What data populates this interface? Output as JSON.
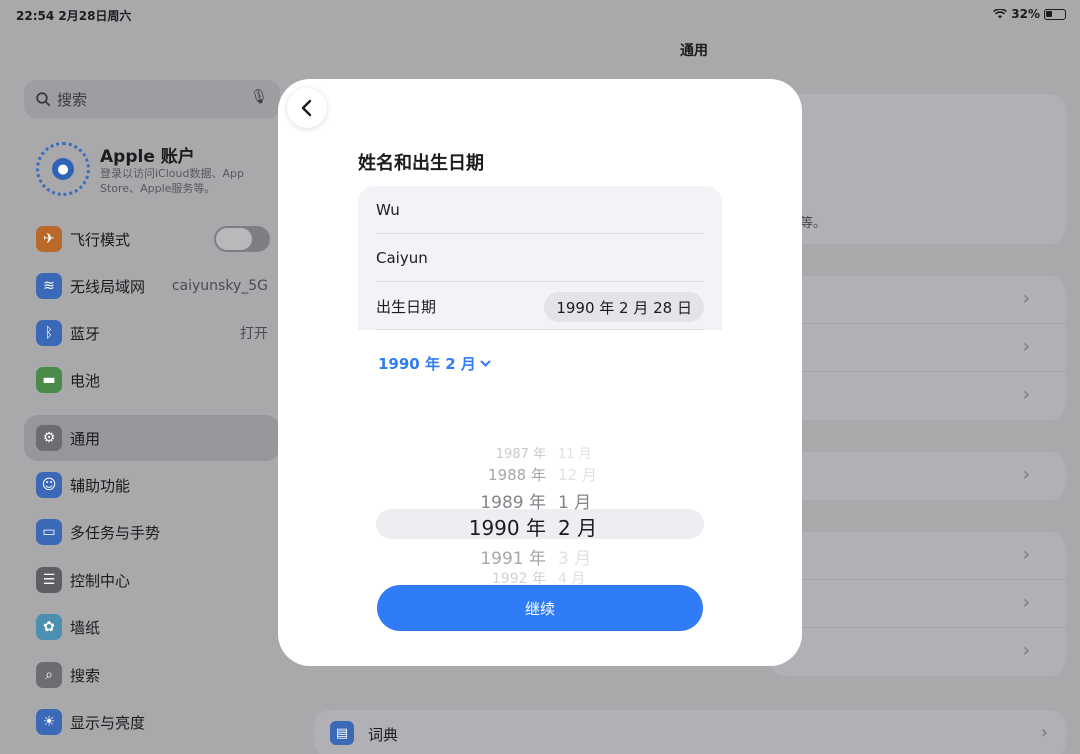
{
  "status": {
    "time_date": "22:54  2月28日周六",
    "battery": "32%"
  },
  "sidebar": {
    "search_placeholder": "搜索",
    "account": {
      "name": "Apple 账户",
      "desc": "登录以访问iCloud数据、App Store、Apple服务等。"
    },
    "items": [
      {
        "label": "飞行模式",
        "icon": "airplane-icon",
        "value": ""
      },
      {
        "label": "无线局域网",
        "icon": "wifi-icon",
        "value": "caiyunsky_5G"
      },
      {
        "label": "蓝牙",
        "icon": "bluetooth-icon",
        "value": "打开"
      },
      {
        "label": "电池",
        "icon": "battery-icon",
        "value": ""
      },
      {
        "label": "通用",
        "icon": "gear-icon",
        "value": ""
      },
      {
        "label": "辅助功能",
        "icon": "accessibility-icon",
        "value": ""
      },
      {
        "label": "多任务与手势",
        "icon": "multitasking-icon",
        "value": ""
      },
      {
        "label": "控制中心",
        "icon": "control-center-icon",
        "value": ""
      },
      {
        "label": "墙纸",
        "icon": "wallpaper-icon",
        "value": ""
      },
      {
        "label": "搜索",
        "icon": "search-icon",
        "value": ""
      },
      {
        "label": "显示与亮度",
        "icon": "brightness-icon",
        "value": ""
      }
    ]
  },
  "main": {
    "title": "通用",
    "fragment": "等。",
    "dictionary_label": "词典"
  },
  "modal": {
    "title": "姓名和出生日期",
    "first_name": "Wu",
    "last_name": "Caiyun",
    "birthday_label": "出生日期",
    "birthday_value": "1990 年 2 月 28 日",
    "month_selector": "1990 年 2 月",
    "picker": {
      "years": [
        "1987 年",
        "1988 年",
        "1989 年",
        "1990 年",
        "1991 年",
        "1992 年"
      ],
      "months": [
        "11 月",
        "12 月",
        "1 月",
        "2 月",
        "3 月",
        "4 月"
      ]
    },
    "continue_label": "继续"
  },
  "colors": {
    "accent": "#2f7cf6"
  }
}
